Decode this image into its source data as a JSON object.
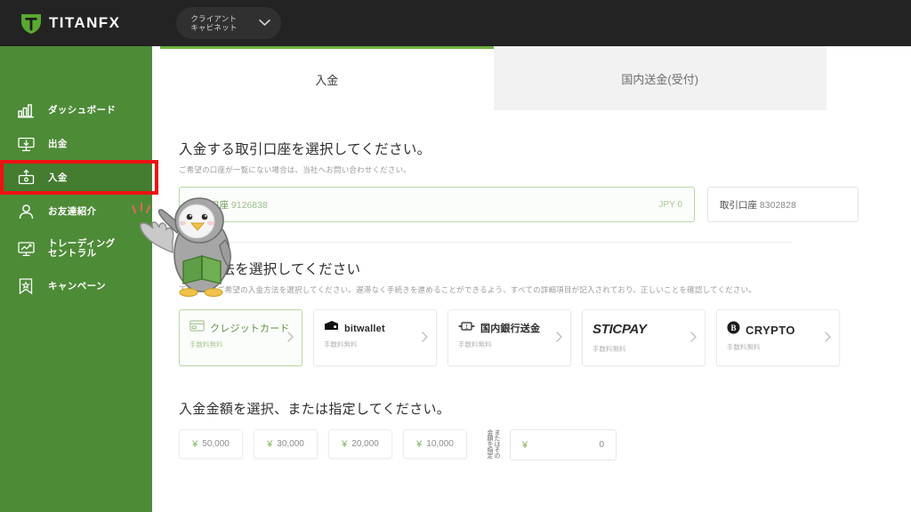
{
  "header": {
    "brand": "TITANFX",
    "logo_icon": "titan-shield-logo",
    "cabinet_button": "クライアント\nキャビネット",
    "chevron_icon": "chevron-down-icon"
  },
  "sidebar": {
    "bg_color": "#4d8b37",
    "active_bg_color": "#447c30",
    "items": [
      {
        "label": "ダッシュボード",
        "icon": "bar-chart-icon",
        "active": false
      },
      {
        "label": "出金",
        "icon": "withdraw-monitor-icon",
        "active": false
      },
      {
        "label": "入金",
        "icon": "deposit-box-icon",
        "active": true
      },
      {
        "label": "お友達紹介",
        "icon": "person-icon",
        "active": false
      },
      {
        "label": "トレーディング\nセントラル",
        "icon": "trading-monitor-icon",
        "active": false
      },
      {
        "label": "キャンペーン",
        "icon": "bookmark-star-icon",
        "active": false
      }
    ]
  },
  "annotation": {
    "highlight_color": "#ee1111",
    "target": "入金"
  },
  "main": {
    "tabs": [
      {
        "label": "入金",
        "active": true
      },
      {
        "label": "国内送金(受付)",
        "active": false
      }
    ],
    "accent_color": "#6cb33f",
    "account_section": {
      "title": "入金する取引口座を選択してください。",
      "subtitle": "ご希望の口座が一覧にない場合は、当社へお問い合わせください。",
      "accounts": [
        {
          "label": "取引口座",
          "number": "9126838",
          "balance": "JPY 0",
          "selected": true
        },
        {
          "label": "取引口座",
          "number": "8302828",
          "balance": "",
          "selected": false
        }
      ]
    },
    "method_section": {
      "title": "入金方法を選択してください",
      "subtitle": "下記より、ご希望の入金方法を選択してください。遅滞なく手続きを進めることができるよう、すべての詳細項目が記入されており、正しいことを確認してください。",
      "methods": [
        {
          "name": "クレジットカード",
          "fee": "手数料無料",
          "icon": "credit-card-icon",
          "selected": true
        },
        {
          "name": "bitwallet",
          "fee": "手数料無料",
          "icon": "bitwallet-icon",
          "selected": false
        },
        {
          "name": "国内銀行送金",
          "fee": "手数料無料",
          "icon": "bank-transfer-icon",
          "selected": false
        },
        {
          "name": "STICPAY",
          "fee": "手数料無料",
          "icon": "sticpay-icon",
          "selected": false
        },
        {
          "name": "CRYPTO",
          "fee": "手数料無料",
          "icon": "bitcoin-icon",
          "selected": false
        }
      ],
      "arrow_icon": "chevron-right-icon"
    },
    "amount_section": {
      "title": "入金金額を選択、または指定してください。",
      "currency_symbol": "¥",
      "presets": [
        "50,000",
        "30,000",
        "20,000",
        "10,000"
      ],
      "or_label": "またはその金額を指定",
      "input_value": "0",
      "input_placeholder": "0"
    }
  },
  "mascot": {
    "name": "penguin-mascot",
    "body_color": "#9a9a9a",
    "book_color": "#5e9e45"
  }
}
